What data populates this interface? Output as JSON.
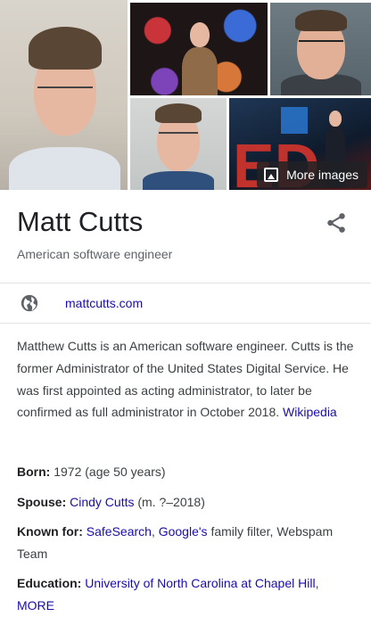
{
  "images": {
    "more_images_label": "More images",
    "icon": "image-icon"
  },
  "header": {
    "title": "Matt Cutts",
    "subtitle": "American software engineer",
    "share_icon": "share-icon"
  },
  "website": {
    "icon": "globe-icon",
    "label": "mattcutts.com"
  },
  "description": {
    "text": "Matthew Cutts is an American software engineer. Cutts is the former Administrator of the United States Digital Service. He was first appointed as acting administrator, to later be confirmed as full administrator in October 2018.",
    "source_link": "Wikipedia"
  },
  "facts": {
    "born": {
      "label": "Born:",
      "value": "1972 (age 50 years)"
    },
    "spouse": {
      "label": "Spouse:",
      "link": "Cindy Cutts",
      "suffix": "(m. ?–2018)"
    },
    "known_for": {
      "label": "Known for:",
      "link1": "SafeSearch",
      "sep": ",",
      "link2": "Google's",
      "suffix": "family filter, Webspam Team"
    },
    "education": {
      "label": "Education:",
      "link": "University of North Carolina at Chapel Hill",
      "sep": ",",
      "more": "MORE"
    }
  },
  "colors": {
    "link": "#1a0dab",
    "text": "#3c4043",
    "muted": "#5f6368"
  }
}
